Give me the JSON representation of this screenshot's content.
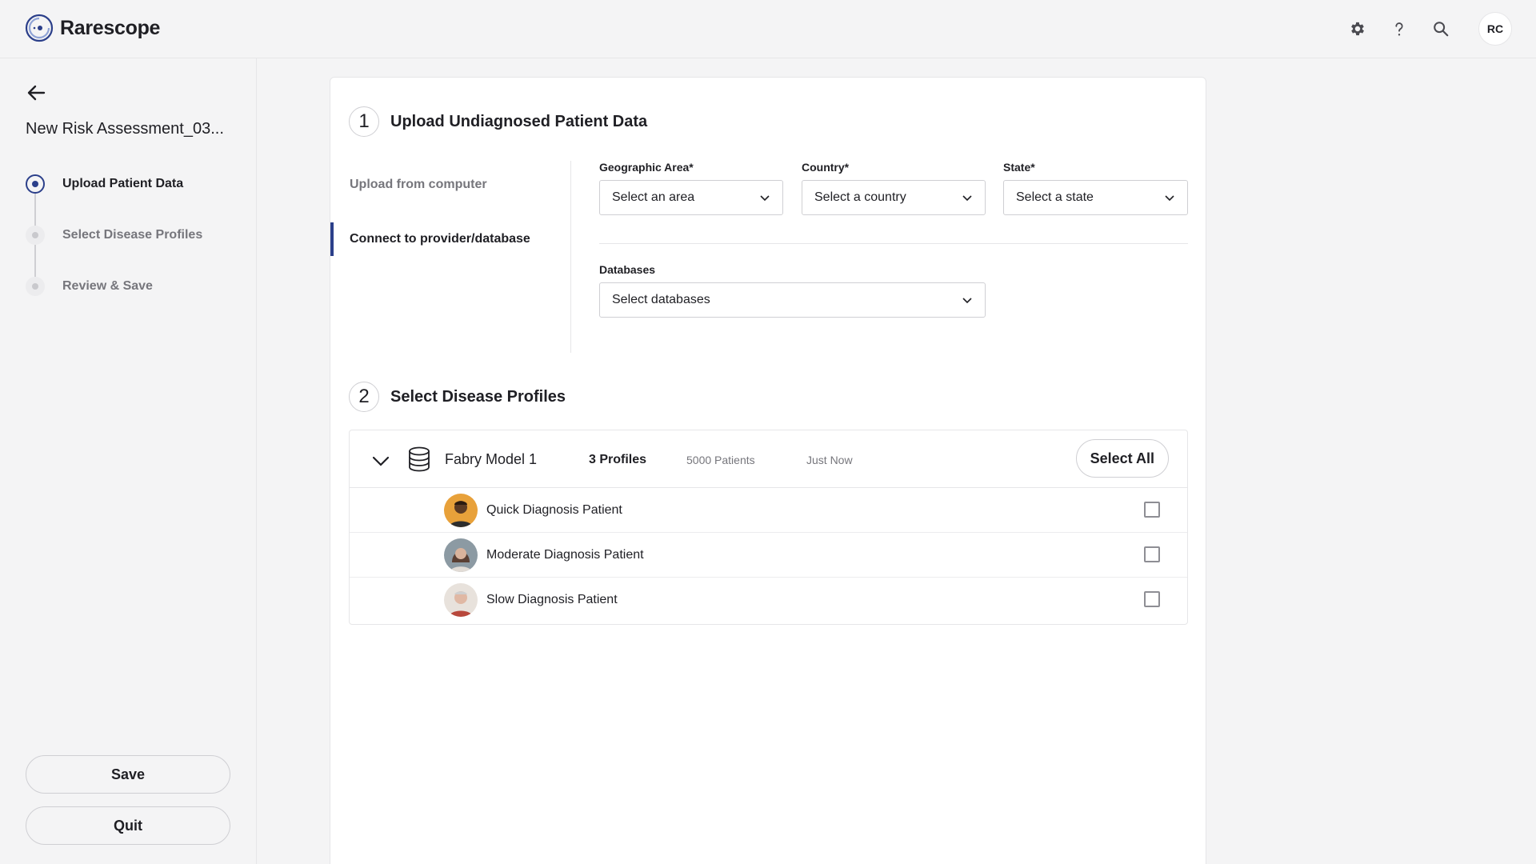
{
  "app": {
    "name": "Rarescope"
  },
  "header": {
    "user_initials": "RC"
  },
  "sidebar": {
    "title": "New Risk Assessment_03...",
    "steps": [
      {
        "label": "Upload Patient Data",
        "state": "active"
      },
      {
        "label": "Select Disease Profiles",
        "state": "inactive"
      },
      {
        "label": "Review & Save",
        "state": "inactive"
      }
    ],
    "save_label": "Save",
    "quit_label": "Quit"
  },
  "section1": {
    "number": "1",
    "title": "Upload Undiagnosed Patient Data",
    "tabs": [
      {
        "label": "Upload from computer",
        "active": false
      },
      {
        "label": "Connect to provider/database",
        "active": true
      }
    ],
    "fields": {
      "area": {
        "label": "Geographic Area*",
        "value": "Select an area"
      },
      "country": {
        "label": "Country*",
        "value": "Select a country"
      },
      "state": {
        "label": "State*",
        "value": "Select a state"
      },
      "databases": {
        "label": "Databases",
        "value": "Select databases"
      }
    }
  },
  "section2": {
    "number": "2",
    "title": "Select Disease Profiles",
    "model": {
      "name": "Fabry Model 1",
      "profiles": "3 Profiles",
      "patients": "5000 Patients",
      "updated": "Just Now",
      "select_all_label": "Select All",
      "patients_list": [
        {
          "name": "Quick Diagnosis Patient",
          "checked": false
        },
        {
          "name": "Moderate Diagnosis Patient",
          "checked": false
        },
        {
          "name": "Slow Diagnosis Patient",
          "checked": false
        }
      ]
    }
  },
  "colors": {
    "accent": "#2b3f8a",
    "background": "#f4f4f5",
    "card": "#ffffff"
  }
}
